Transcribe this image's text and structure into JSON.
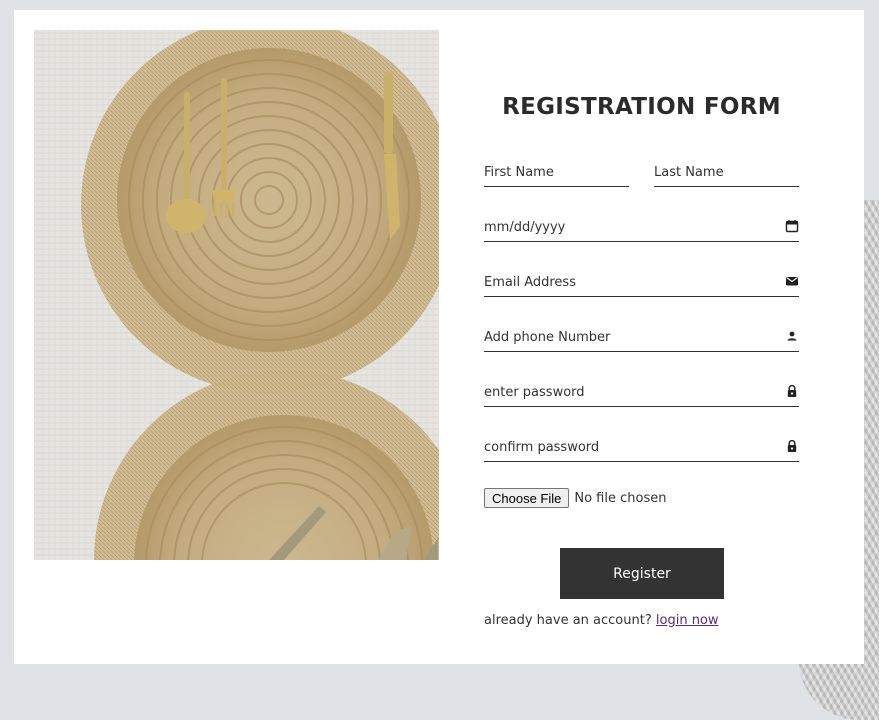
{
  "form": {
    "title": "REGISTRATION FORM",
    "first_name_placeholder": "First Name",
    "last_name_placeholder": "Last Name",
    "date_placeholder": "mm/dd/yyyy",
    "email_placeholder": "Email Address",
    "phone_placeholder": "Add phone Number",
    "password_placeholder": "enter password",
    "confirm_password_placeholder": "confirm password",
    "file_button_label": "Choose File",
    "file_status": "No file chosen",
    "register_label": "Register",
    "login_prompt": "already have an account?",
    "login_link": "login now"
  },
  "icons": {
    "date": "calendar-icon",
    "email": "envelope-icon",
    "phone": "person-icon",
    "password": "lock-icon",
    "confirm_password": "lock-icon"
  },
  "colors": {
    "page_background": "#dfe3e8",
    "card_background": "#ffffff",
    "button_background": "#333333",
    "text": "#333333",
    "link": "#5a2a7a"
  }
}
